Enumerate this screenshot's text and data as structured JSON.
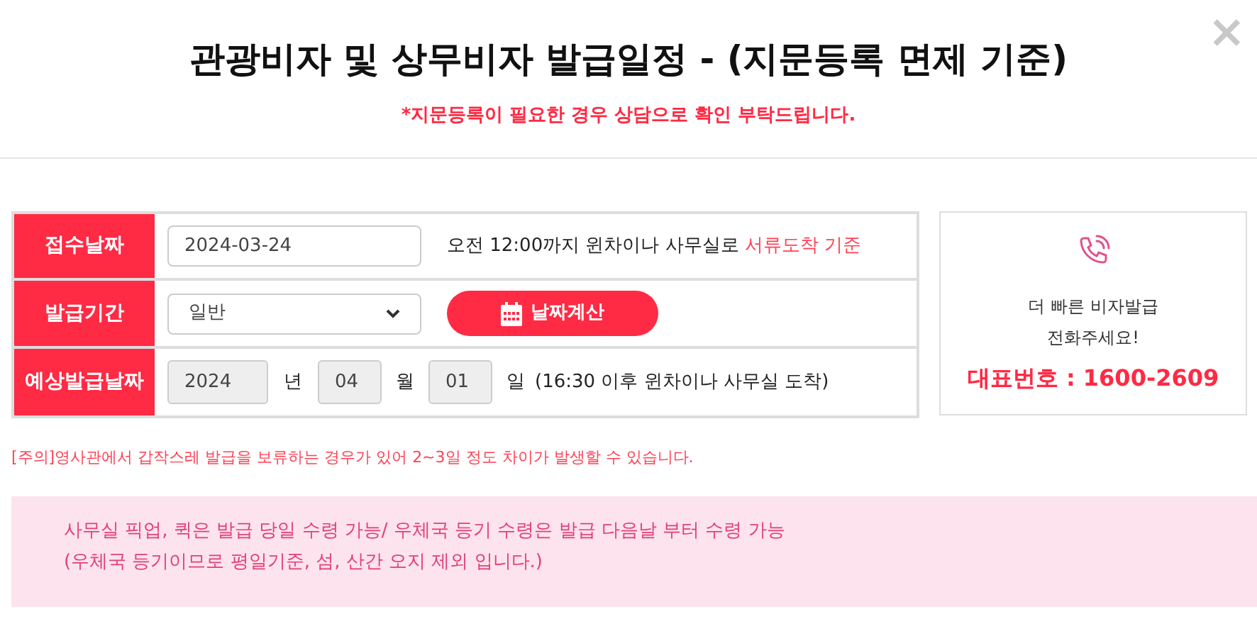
{
  "header": {
    "title": "관광비자 및 상무비자 발급일정 - (지문등록 면제 기준)",
    "notice": "*지문등록이 필요한 경우 상담으로 확인 부탁드립니다.",
    "close": "×"
  },
  "form": {
    "receipt": {
      "label": "접수날짜",
      "value": "2024-03-24",
      "note": "오전 12:00까지 윈차이나 사무실로",
      "note_highlight": "서류도착 기준"
    },
    "period": {
      "label": "발급기간",
      "value": "일반",
      "button": "날짜계산"
    },
    "expected": {
      "label": "예상발급날짜",
      "year": "2024",
      "year_unit": "년",
      "month": "04",
      "month_unit": "월",
      "day": "01",
      "day_unit": "일",
      "note": "(16:30 이후 윈차이나 사무실 도착)"
    }
  },
  "call_card": {
    "line1": "더 빠른 비자발급",
    "line2": "전화주세요!",
    "phone": "대표번호 : 1600-2609"
  },
  "warning": "[주의]영사관에서 갑작스레 발급을 보류하는 경우가 있어 2~3일 정도 차이가 발생할 수 있습니다.",
  "info": [
    "사무실 픽업, 퀵은 발급 당일 수령 가능/ 우체국 등기 수령은 발급 다음날 부터 수령 가능",
    "(우체국 등기이므로 평일기준, 섬, 산간 오지 제외 입니다.)"
  ]
}
